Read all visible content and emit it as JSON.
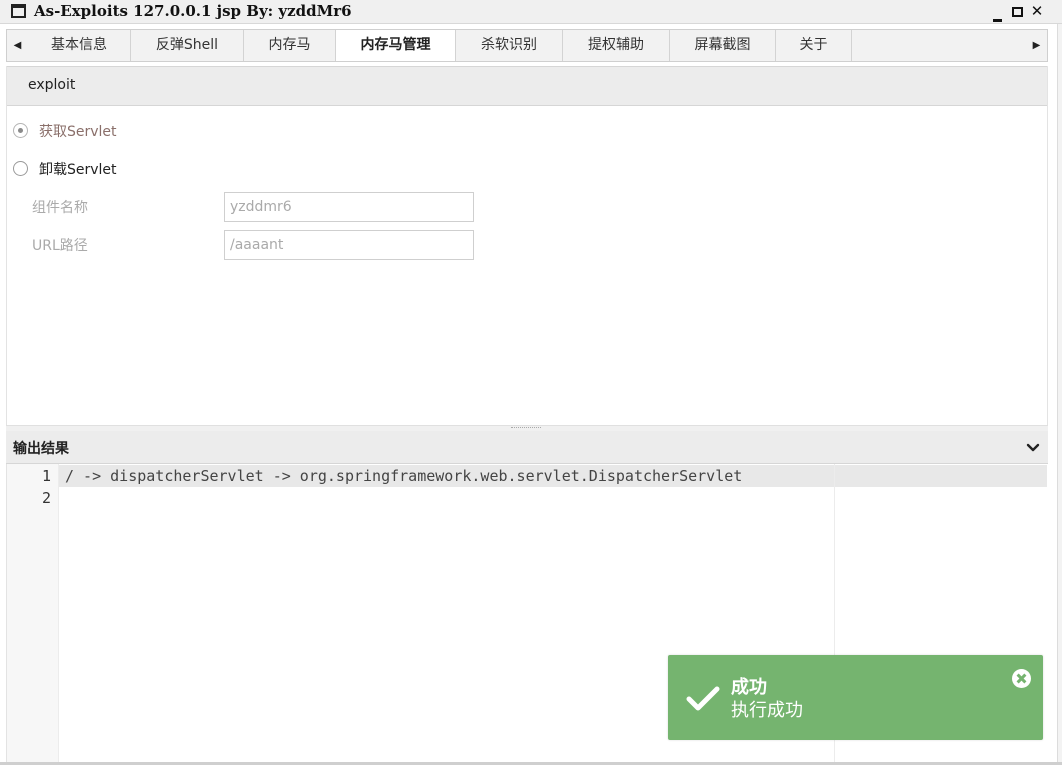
{
  "window": {
    "title": "As-Exploits 127.0.0.1 jsp By: yzddMr6",
    "minimize_label": "",
    "maximize_label": "",
    "close_label": "✕"
  },
  "tabs": [
    {
      "label": "基本信息"
    },
    {
      "label": "反弹Shell"
    },
    {
      "label": "内存马"
    },
    {
      "label": "内存马管理"
    },
    {
      "label": "杀软识别"
    },
    {
      "label": "提权辅助"
    },
    {
      "label": "屏幕截图"
    },
    {
      "label": "关于"
    }
  ],
  "tab_scroll": {
    "left": "◀",
    "right": "▶"
  },
  "active_tab": "内存马管理",
  "exploit_panel": {
    "header": "exploit",
    "radios": [
      {
        "label": "获取Servlet",
        "checked": true
      },
      {
        "label": "卸载Servlet",
        "checked": false
      }
    ],
    "fields": [
      {
        "label": "组件名称",
        "value": "yzddmr6"
      },
      {
        "label": "URL路径",
        "value": "/aaaant"
      }
    ]
  },
  "output": {
    "title": "输出结果",
    "lines": [
      {
        "no": "1",
        "text": "/ -> dispatcherServlet -> org.springframework.web.servlet.DispatcherServlet"
      },
      {
        "no": "2",
        "text": ""
      }
    ]
  },
  "toast": {
    "title": "成功",
    "message": "执行成功",
    "color": "#75b46f"
  }
}
